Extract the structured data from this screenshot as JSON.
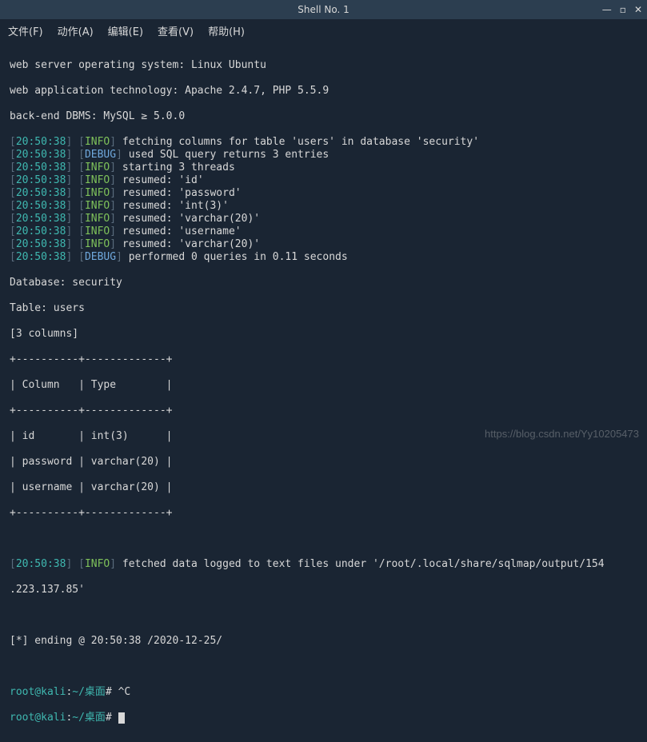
{
  "window": {
    "title": "Shell No. 1",
    "controls": {
      "min": "—",
      "max": "▫",
      "close": "✕"
    }
  },
  "menu": {
    "file": "文件(F)",
    "actions": "动作(A)",
    "edit": "编辑(E)",
    "view": "查看(V)",
    "help": "帮助(H)"
  },
  "preamble": {
    "l1": "web server operating system: Linux Ubuntu",
    "l2": "web application technology: Apache 2.4.7, PHP 5.5.9",
    "l3": "back-end DBMS: MySQL ≥ 5.0.0"
  },
  "logs": [
    {
      "ts": "20:50:38",
      "lvl": "INFO",
      "msg": "fetching columns for table 'users' in database 'security'"
    },
    {
      "ts": "20:50:38",
      "lvl": "DEBUG",
      "msg": "used SQL query returns 3 entries"
    },
    {
      "ts": "20:50:38",
      "lvl": "INFO",
      "msg": "starting 3 threads"
    },
    {
      "ts": "20:50:38",
      "lvl": "INFO",
      "msg": "resumed: 'id'"
    },
    {
      "ts": "20:50:38",
      "lvl": "INFO",
      "msg": "resumed: 'password'"
    },
    {
      "ts": "20:50:38",
      "lvl": "INFO",
      "msg": "resumed: 'int(3)'"
    },
    {
      "ts": "20:50:38",
      "lvl": "INFO",
      "msg": "resumed: 'varchar(20)'"
    },
    {
      "ts": "20:50:38",
      "lvl": "INFO",
      "msg": "resumed: 'username'"
    },
    {
      "ts": "20:50:38",
      "lvl": "INFO",
      "msg": "resumed: 'varchar(20)'"
    },
    {
      "ts": "20:50:38",
      "lvl": "DEBUG",
      "msg": "performed 0 queries in 0.11 seconds"
    }
  ],
  "db_info": {
    "db": "Database: security",
    "tbl": "Table: users",
    "cols": "[3 columns]"
  },
  "table_ascii": {
    "border_top": "+----------+-------------+",
    "header": "| Column   | Type        |",
    "border_mid": "+----------+-------------+",
    "r1": "| id       | int(3)      |",
    "r2": "| password | varchar(20) |",
    "r3": "| username | varchar(20) |",
    "border_bot": "+----------+-------------+"
  },
  "final_log": {
    "ts": "20:50:38",
    "lvl": "INFO",
    "msg1": "fetched data logged to text files under '/root/.local/share/sqlmap/output/154",
    "msg2": ".223.137.85'"
  },
  "ending": "[*] ending @ 20:50:38 /2020-12-25/",
  "prompt": {
    "user": "root@kali",
    "sep1": ":",
    "path": "~/桌面",
    "hash": "#",
    "cmd1": " ^C",
    "cmd2": " "
  },
  "watermark": "https://blog.csdn.net/Yy10205473"
}
